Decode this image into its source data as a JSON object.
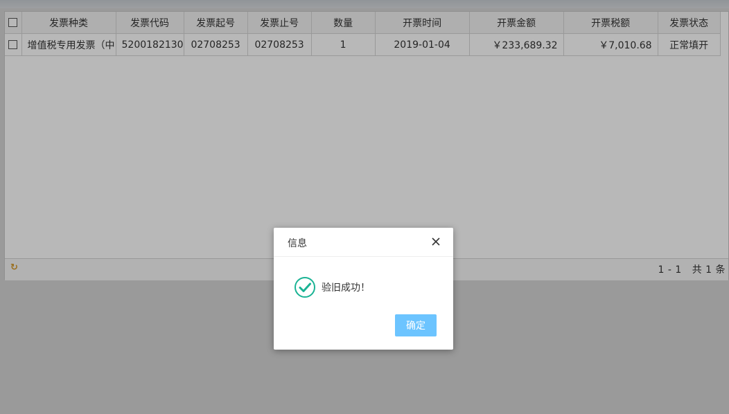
{
  "table": {
    "headers": [
      "发票种类",
      "发票代码",
      "发票起号",
      "发票止号",
      "数量",
      "开票时间",
      "开票金额",
      "开票税额",
      "发票状态"
    ],
    "rows": [
      {
        "invoice_type": "增值税专用发票（中",
        "invoice_code": "5200182130",
        "start_no": "02708253",
        "end_no": "02708253",
        "quantity": "1",
        "issue_date": "2019-01-04",
        "amount": "￥233,689.32",
        "tax": "￥7,010.68",
        "status": "正常填开"
      }
    ]
  },
  "pager": {
    "refresh_icon": "refresh-icon",
    "range": "1 - 1",
    "total": "共 1 条"
  },
  "dialog": {
    "title": "信息",
    "message": "验旧成功！",
    "confirm_label": "确定",
    "icon": "success-check-icon",
    "accent_color": "#1ab394",
    "button_color": "#6cc4ff"
  }
}
